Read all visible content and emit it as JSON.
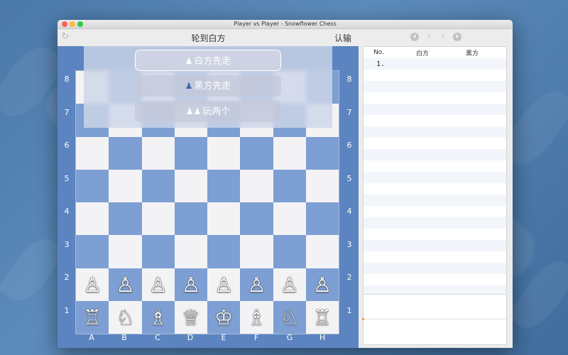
{
  "window": {
    "title": "Player vs Player - Snowflower Chess"
  },
  "toolbar": {
    "refresh_icon": "refresh-icon",
    "turn_label": "轮到白方",
    "resign_label": "认输",
    "nav_first": "⏴",
    "nav_prev": "‹",
    "nav_next": "›",
    "nav_last": "⏵"
  },
  "board": {
    "ranks": [
      "8",
      "7",
      "6",
      "5",
      "4",
      "3",
      "2",
      "1"
    ],
    "files": [
      "A",
      "B",
      "C",
      "D",
      "E",
      "F",
      "G",
      "H"
    ],
    "light_color": "#f3f3f5",
    "dark_color": "#7d9fd3",
    "rank2_pieces": [
      "♙",
      "♙",
      "♙",
      "♙",
      "♙",
      "♙",
      "♙",
      "♙"
    ],
    "rank1_pieces": [
      "♖",
      "♘",
      "♗",
      "♕",
      "♔",
      "♗",
      "♘",
      "♖"
    ]
  },
  "menu": {
    "white_first": "白方先走",
    "white_first_icon": "♟",
    "black_first": "黑方先走",
    "black_first_icon": "♟",
    "two_player": "玩两个",
    "two_player_icon": "♟♟"
  },
  "moves": {
    "col_no": "No.",
    "col_white": "白方",
    "col_black": "黑方",
    "rows": [
      {
        "no": "1.",
        "white": "",
        "black": ""
      }
    ]
  }
}
